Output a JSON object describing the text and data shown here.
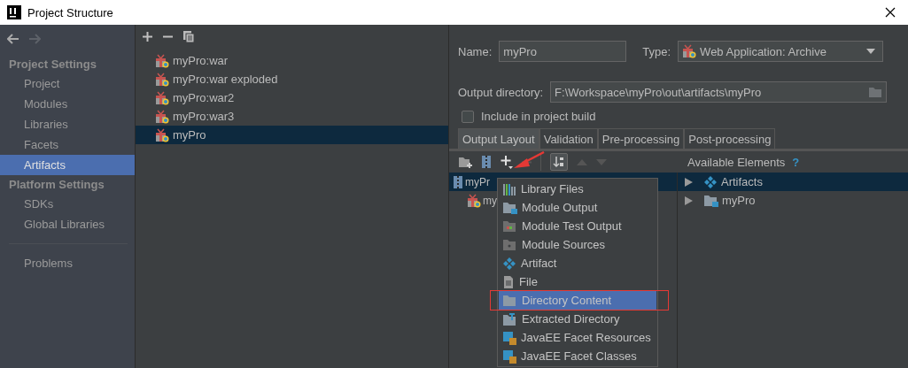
{
  "window": {
    "title": "Project Structure"
  },
  "sidebar": {
    "sections": [
      {
        "title": "Project Settings",
        "items": [
          {
            "label": "Project",
            "selected": false
          },
          {
            "label": "Modules",
            "selected": false
          },
          {
            "label": "Libraries",
            "selected": false
          },
          {
            "label": "Facets",
            "selected": false
          },
          {
            "label": "Artifacts",
            "selected": true
          }
        ]
      },
      {
        "title": "Platform Settings",
        "items": [
          {
            "label": "SDKs",
            "selected": false
          },
          {
            "label": "Global Libraries",
            "selected": false
          }
        ]
      },
      {
        "items": [
          {
            "label": "Problems",
            "selected": false
          }
        ]
      }
    ]
  },
  "artifacts": [
    {
      "label": "myPro:war",
      "selected": false
    },
    {
      "label": "myPro:war exploded",
      "selected": false
    },
    {
      "label": "myPro:war2",
      "selected": false
    },
    {
      "label": "myPro:war3",
      "selected": false
    },
    {
      "label": "myPro",
      "selected": true
    }
  ],
  "form": {
    "name_label": "Name:",
    "name_value": "myPro",
    "type_label": "Type:",
    "type_value": "Web Application: Archive",
    "output_label": "Output directory:",
    "output_value": "F:\\Workspace\\myPro\\out\\artifacts\\myPro",
    "include_label": "Include in project build",
    "include_checked": false
  },
  "tabs": [
    {
      "label": "Output Layout",
      "selected": true
    },
    {
      "label": "Validation",
      "selected": false
    },
    {
      "label": "Pre-processing",
      "selected": false
    },
    {
      "label": "Post-processing",
      "selected": false
    }
  ],
  "available_title": "Available Elements",
  "help": "?",
  "layout_tree": [
    {
      "label": "myPr",
      "kind": "archive",
      "selected": true
    },
    {
      "label": "my",
      "kind": "artifact",
      "selected": false
    }
  ],
  "available_tree": [
    {
      "label": "Artifacts",
      "kind": "artifacts",
      "selected": true,
      "expanded": false
    },
    {
      "label": "myPro",
      "kind": "module",
      "selected": false,
      "expanded": false
    }
  ],
  "popup_menu": [
    {
      "label": "Library Files",
      "kind": "library",
      "selected": false,
      "highlighted": false
    },
    {
      "label": "Module Output",
      "kind": "module",
      "selected": false,
      "highlighted": false
    },
    {
      "label": "Module Test Output",
      "kind": "test",
      "selected": false,
      "highlighted": false
    },
    {
      "label": "Module Sources",
      "kind": "sources",
      "selected": false,
      "highlighted": false
    },
    {
      "label": "Artifact",
      "kind": "artifact",
      "selected": false,
      "highlighted": false
    },
    {
      "label": "File",
      "kind": "file",
      "selected": false,
      "highlighted": false
    },
    {
      "label": "Directory Content",
      "kind": "folder",
      "selected": true,
      "highlighted": true
    },
    {
      "label": "Extracted Directory",
      "kind": "extracted",
      "selected": false,
      "highlighted": false
    },
    {
      "label": "JavaEE Facet Resources",
      "kind": "javaee",
      "selected": false,
      "highlighted": false
    },
    {
      "label": "JavaEE Facet Classes",
      "kind": "javaee",
      "selected": false,
      "highlighted": false
    }
  ]
}
